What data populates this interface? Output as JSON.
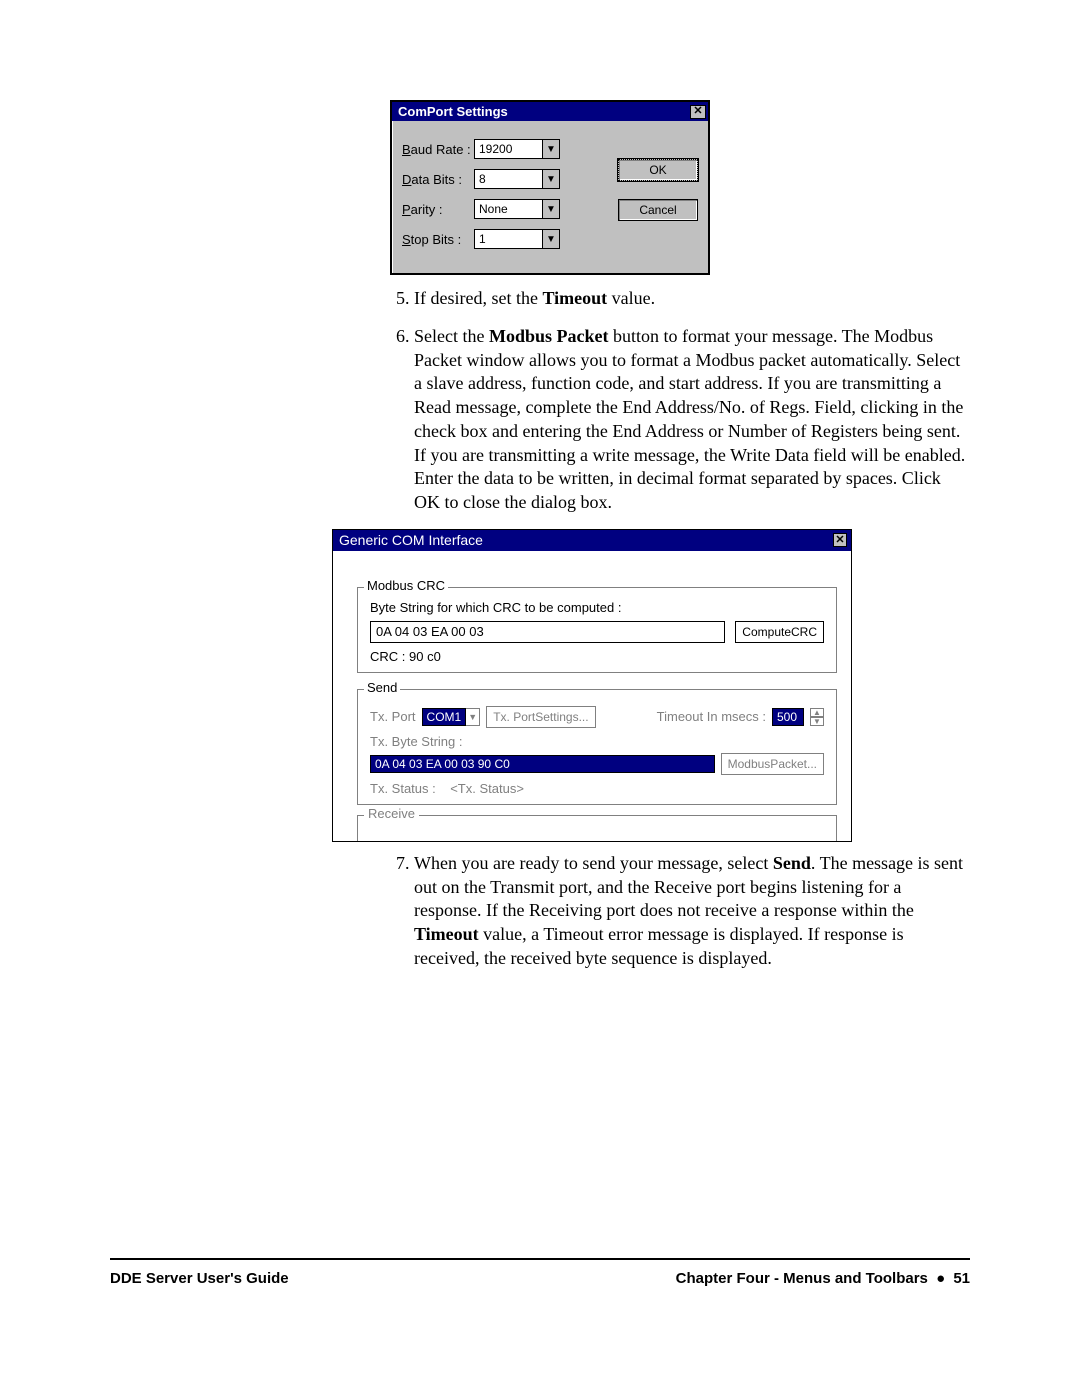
{
  "comport_dialog": {
    "title": "ComPort Settings",
    "rows": {
      "baud_label_pre": "B",
      "baud_label_post": "aud Rate :",
      "baud_value": "19200",
      "data_label_pre": "D",
      "data_label_post": "ata Bits :",
      "data_value": "8",
      "parity_label_pre": "P",
      "parity_label_post": "arity :",
      "parity_value": "None",
      "stop_label_pre": "S",
      "stop_label_post": "top Bits :",
      "stop_value": "1"
    },
    "ok_label": "OK",
    "cancel_label": "Cancel"
  },
  "steps_a": {
    "num5": "5.",
    "txt5": "If desired, set the ",
    "b5": "Timeout",
    "txt5_tail": " value.",
    "num6": "6.",
    "txt6a": "Select the ",
    "b6": "Modbus Packet",
    "txt6b": " button to format your message. The Modbus Packet window allows you to format a Modbus packet automatically. Select a slave address, function code, and start address. If you are transmitting a Read message, complete the End Address/No. of Regs. Field, clicking in the check box and entering the End Address or Number of Registers being sent. If you are transmitting a write message, the Write Data field will be enabled. Enter the data to be written, in decimal format separated by spaces. Click OK to close the dialog box."
  },
  "generic_dialog": {
    "title": "Generic COM Interface",
    "crc_group": "Modbus CRC",
    "crc_label_pre": "B",
    "crc_label_post": "yte String for which CRC to be computed :",
    "crc_input": "0A 04 03 EA 00 03",
    "compute_btn_pre": "C",
    "compute_btn_post": "omputeCRC",
    "crc_result": "CRC :  90 c0",
    "send_group": "Send",
    "txport_label_pre": "T",
    "txport_label_post": "x. Port",
    "txport_value": "COM1",
    "txport_settings_pre": "Tx. Port ",
    "txport_settings_u": "S",
    "txport_settings_post": "ettings...",
    "timeout_label_a": "Timeout In ",
    "timeout_label_u": "m",
    "timeout_label_b": "secs :",
    "timeout_value": "500",
    "tx_bytestring_label": "Tx. Byte String :",
    "tx_bytestring_value": "0A 04 03 EA 00 03 90 C0",
    "modbus_packet_btn_a": "Modbus ",
    "modbus_packet_btn_u": "P",
    "modbus_packet_btn_b": "acket...",
    "tx_status_label": "Tx. Status :",
    "tx_status_value": "<Tx. Status>",
    "receive_group": "Receive"
  },
  "steps_b": {
    "num7": "7.",
    "txt7a": "When you are ready to send your message, select ",
    "b7a": "Send",
    "txt7b": ". The message is sent out on the Transmit port, and the Receive port begins listening for a response. If the Receiving port does not receive a response within the ",
    "b7b": "Timeout",
    "txt7c": " value, a Timeout error message is displayed. If response is received, the received byte sequence is displayed."
  },
  "footer": {
    "left": "DDE Server User's Guide",
    "right_a": "Chapter Four - Menus and Toolbars",
    "right_dot": "●",
    "right_b": "51"
  }
}
